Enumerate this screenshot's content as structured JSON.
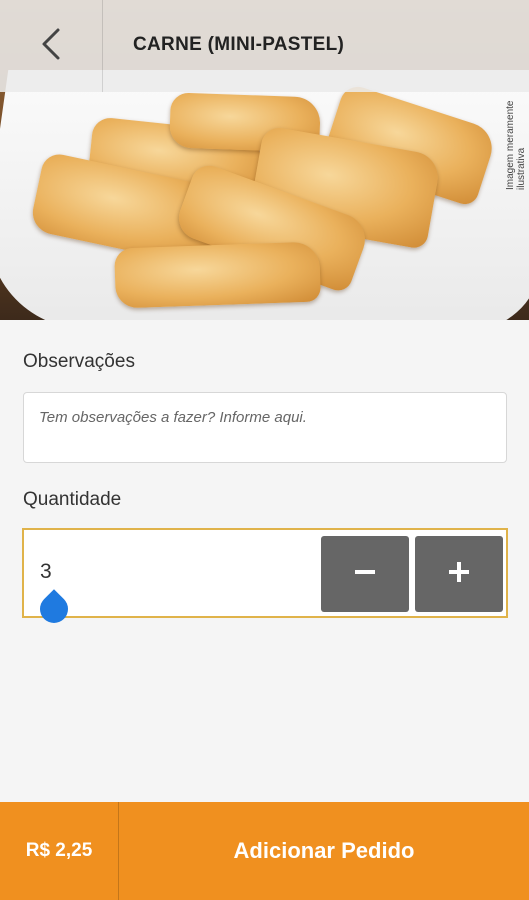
{
  "header": {
    "title": "CARNE (MINI-PASTEL)",
    "back_icon": "chevron-left-icon",
    "image_caption": "Imagem meramente ilustrativa"
  },
  "form": {
    "observations_label": "Observações",
    "observations_placeholder": "Tem observações a fazer?  Informe aqui.",
    "observations_value": "",
    "quantity_label": "Quantidade",
    "quantity_value": "3",
    "decrement_icon": "minus-icon",
    "increment_icon": "plus-icon"
  },
  "footer": {
    "price": "R$ 2,25",
    "add_label": "Adicionar Pedido"
  },
  "colors": {
    "accent": "#f0901f",
    "quantity_border": "#e0b34a",
    "stepper": "#666666",
    "cursor": "#1f7ae0"
  }
}
